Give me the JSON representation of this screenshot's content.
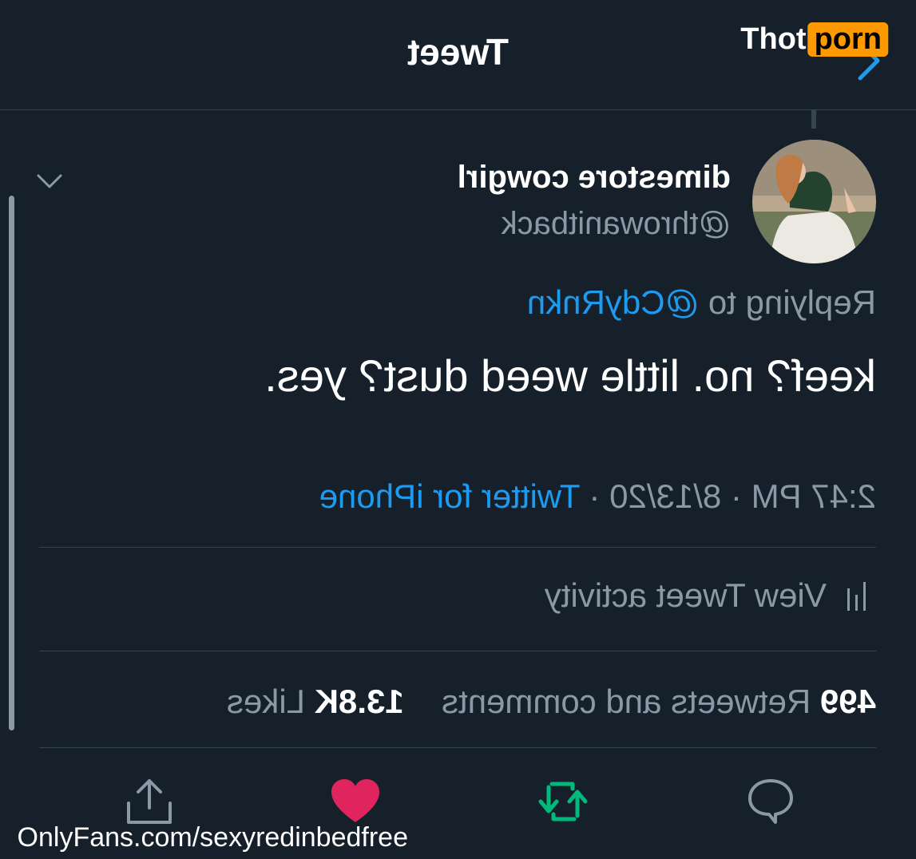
{
  "header": {
    "title": "Tweet"
  },
  "tweet": {
    "display_name": "dimestore cowgirl",
    "handle": "@throwanitback",
    "replying_prefix": "Replying to",
    "replying_mention": "@CdyRnkn",
    "text": "keef? no. little weed dust? yes.",
    "time": "2:47 PM",
    "date": "8/13/20",
    "separator": "·",
    "source": "Twitter for iPhone",
    "activity_label": "View Tweet activity",
    "retweets_count": "499",
    "retweets_label": "Retweets and comments",
    "likes_count": "13.8K",
    "likes_label": "Likes"
  },
  "actions": {
    "reply_icon": "reply-bubble-icon",
    "retweet_icon": "retweet-arrows-icon",
    "like_icon": "heart-icon",
    "share_icon": "share-upload-icon"
  },
  "colors": {
    "background": "#15202b",
    "accent": "#1d9bf0",
    "muted": "#8b98a5",
    "retweet": "#00ba7c",
    "like": "#f91880",
    "divider": "#38444d"
  },
  "watermarks": {
    "logo_part1": "Thot",
    "logo_part2": "porn",
    "url": "OnlyFans.com/sexyredinbedfree"
  }
}
